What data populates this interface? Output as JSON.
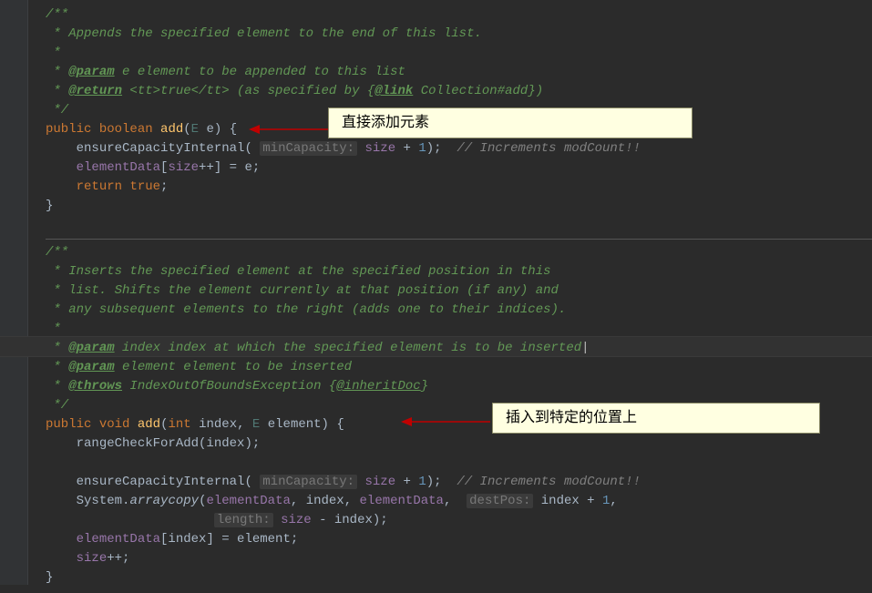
{
  "doc1": {
    "l1": "/**",
    "l2_a": " * Appends the specified element to the end of this list.",
    "l3": " *",
    "l4_a": " * ",
    "l4_tag": "@param",
    "l4_b": " e element to be appended to this list",
    "l5_a": " * ",
    "l5_tag": "@return",
    "l5_b": " <tt>true</tt> (as specified by {",
    "l5_link": "@link",
    "l5_c": " Collection#add})",
    "l6": " */"
  },
  "method1": {
    "kw_public": "public",
    "kw_boolean": "boolean",
    "name": "add",
    "ptype": "E",
    "pname": "e",
    "hint_minCap": "minCapacity:",
    "call1": "ensureCapacityInternal",
    "field_size": "size",
    "num1": "1",
    "comment1": "// Increments modCount!!",
    "field_elementData": "elementData",
    "op_pp": "++",
    "assign_e": " = e;",
    "kw_return": "return",
    "kw_true": "true"
  },
  "doc2": {
    "l1": "/**",
    "l2": " * Inserts the specified element at the specified position in this",
    "l3": " * list. Shifts the element currently at that position (if any) and",
    "l4": " * any subsequent elements to the right (adds one to their indices).",
    "l5": " *",
    "l6_a": " * ",
    "l6_tag": "@param",
    "l6_b": " index index at which the specified element is to be inserted",
    "l7_a": " * ",
    "l7_tag": "@param",
    "l7_b": " element element to be inserted",
    "l8_a": " * ",
    "l8_tag": "@throws",
    "l8_b": " IndexOutOfBoundsException {",
    "l8_link": "@inheritDoc",
    "l8_c": "}",
    "l9": " */"
  },
  "method2": {
    "kw_public": "public",
    "kw_void": "void",
    "name": "add",
    "kw_int": "int",
    "p1": "index",
    "ptype2": "E",
    "p2": "element",
    "call_range": "rangeCheckForAdd",
    "call_ensure": "ensureCapacityInternal",
    "hint_minCap": "minCapacity:",
    "field_size": "size",
    "num1": "1",
    "comment1": "// Increments modCount!!",
    "sys": "System",
    "arraycopy": "arraycopy",
    "field_elementData": "elementData",
    "hint_destPos": "destPos:",
    "hint_length": "length:",
    "assign_line": "elementData[index] = element;",
    "incr_line": "size++;"
  },
  "annotations": {
    "a1": "直接添加元素",
    "a2": "插入到特定的位置上"
  }
}
